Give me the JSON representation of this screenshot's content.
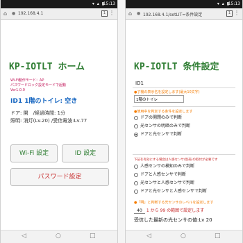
{
  "status_bar": {
    "time": "15:13",
    "icons": "▾ ▴ ▮"
  },
  "left": {
    "url": "192.168.4.1",
    "title": "KP-IOTLT ホーム",
    "mode_lines": [
      "Wi-Fi動作モード：AP",
      "パスワードロック設定モードで起動",
      "Ver1.0.0"
    ],
    "toilet_status": "ID1 1階のトイレ: 空き",
    "info_line1": "ドア: 開　/経過時間: 1分",
    "info_line2": "照明: 消灯(Lv.20) /受信電波:Lv.77",
    "buttons": {
      "wifi": "Wi-Fi 設定",
      "id": "ID 設定",
      "password": "パスワード設定"
    }
  },
  "right": {
    "url": "192.168.4.1/setLIT=条件設定",
    "title": "KP-IOTLT 条件設定",
    "id_label": "ID1",
    "name_note": "●子機の表示名を設定します(最大10文字)",
    "name_value": "1階のトイレ",
    "judge_note": "●使用中を判定する条件を設定します",
    "options_a": [
      "ドアの開閉のみで判断",
      "光センサの明暗のみで判断",
      "ドアと光センサで判断"
    ],
    "selected_a": 2,
    "warn_note": "下記を有効にする場合は人感センサ(別売)の取付が必要です",
    "options_b": [
      "人感センサの検知のみで判断",
      "ドアと人感センサで判断",
      "光センサと人感センサで判断",
      "ドアと光センサと人感センサで判断"
    ],
    "light_note": "●「明」と判断する光センサのレベルを設定します",
    "light_level": "40",
    "light_hint": "1 から 99 の範囲で設定します",
    "last_value": "受信した最新の光センサの値:Lv 20"
  },
  "nav": {
    "back": "◁",
    "home": "○",
    "recent": "□"
  },
  "icons": {
    "home": "home-icon",
    "lock": "lock-icon",
    "tabs": "tabs-icon",
    "menu": "menu-icon"
  }
}
